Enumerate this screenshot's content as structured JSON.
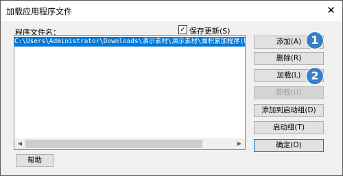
{
  "dialog": {
    "title": "加载应用程序文件",
    "close_glyph": "✕"
  },
  "file_list": {
    "label": "程序文件名：",
    "selected_item": "C:\\Users\\Administrator\\Downloads\\演示素材\\演示素材\\面积累加程序(MJJSD"
  },
  "save_history": {
    "label": "保存更新(S)",
    "checked": true,
    "check_glyph": "✓"
  },
  "buttons": {
    "add": "添加(A)",
    "delete": "删除(R)",
    "load": "加载(L)",
    "unload": "卸载(U)",
    "add_to_startup": "添加到启动组(D)",
    "startup_group": "启动组(T)",
    "ok": "确定(O)",
    "help": "帮助"
  },
  "scrollbar": {
    "left_arrow": "◀",
    "right_arrow": "▶"
  },
  "annotations": {
    "badge_1": "1",
    "badge_2": "2",
    "badge_color": "#3a7fc4"
  }
}
